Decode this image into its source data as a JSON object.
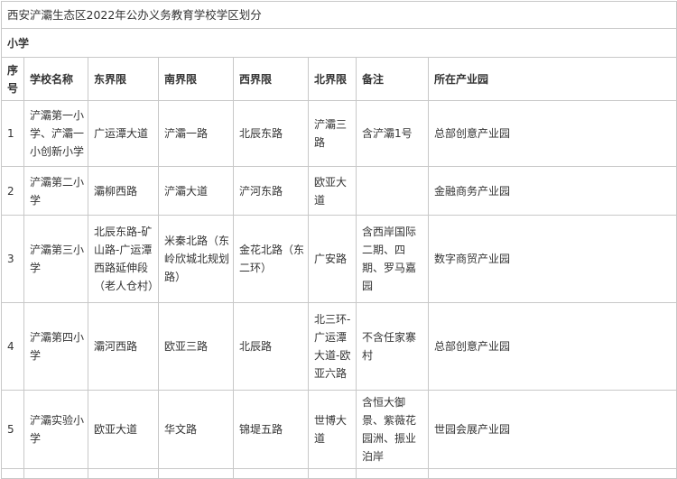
{
  "title": "西安浐灞生态区2022年公办义务教育学校学区划分",
  "section": "小学",
  "headers": [
    "序号",
    "学校名称",
    "东界限",
    "南界限",
    "西界限",
    "北界限",
    "备注",
    "所在产业园"
  ],
  "rows": [
    {
      "no": "1",
      "name": "浐灞第一小学、浐灞一小创新小学",
      "east": "广运潭大道",
      "south": "浐灞一路",
      "west": "北辰东路",
      "north": "浐灞三路",
      "note": "含浐灞1号",
      "park": "总部创意产业园"
    },
    {
      "no": "2",
      "name": "浐灞第二小学",
      "east": "灞柳西路",
      "south": "浐灞大道",
      "west": "浐河东路",
      "north": "欧亚大道",
      "note": "",
      "park": "金融商务产业园"
    },
    {
      "no": "3",
      "name": "浐灞第三小学",
      "east": "北辰东路-矿山路-广运潭西路延伸段（老人仓村）",
      "south": "米秦北路（东岭欣城北规划路）",
      "west": "金花北路（东二环）",
      "north": "广安路",
      "note": "含西岸国际二期、四期、罗马嘉园",
      "park": "数字商贸产业园"
    },
    {
      "no": "4",
      "name": "浐灞第四小学",
      "east": "灞河西路",
      "south": "欧亚三路",
      "west": "北辰路",
      "north": "北三环-广运潭大道-欧亚六路",
      "note": "不含任家寨村",
      "park": "总部创意产业园"
    },
    {
      "no": "5",
      "name": "浐灞实验小学",
      "east": "欧亚大道",
      "south": "华文路",
      "west": "锦堤五路",
      "north": "世博大道",
      "note": "含恒大御景、紫薇花园洲、振业泊岸",
      "park": "世园会展产业园"
    }
  ]
}
